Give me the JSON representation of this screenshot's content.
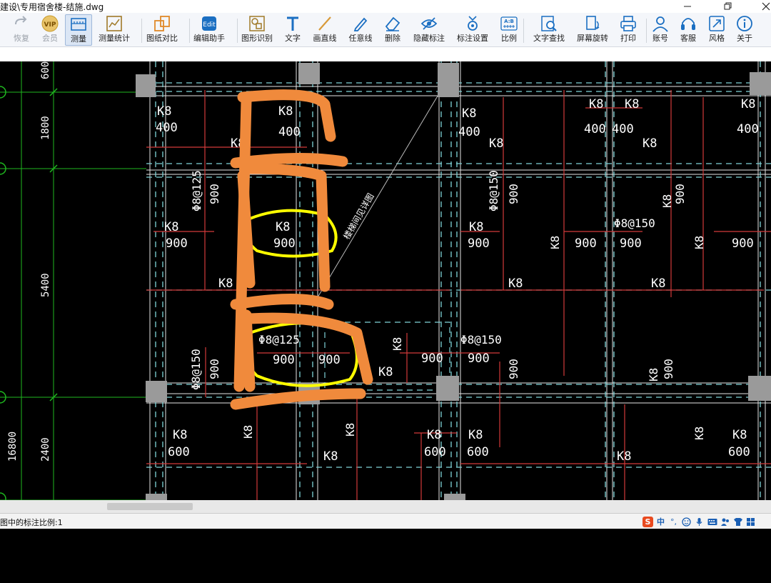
{
  "window": {
    "title": "建设\\专用宿舍楼-结施.dwg"
  },
  "toolbar": {
    "items": [
      {
        "label": "恢复",
        "icon": "redo-icon",
        "disabled": true
      },
      {
        "label": "会员",
        "icon": "vip-icon",
        "disabled": true
      },
      {
        "label": "测量",
        "icon": "measure-icon",
        "active": true
      },
      {
        "label": "测量统计",
        "icon": "measure-stats-icon"
      },
      {
        "label": "图纸对比",
        "icon": "compare-icon"
      },
      {
        "label": "编辑助手",
        "icon": "edit-assistant-icon"
      },
      {
        "label": "图形识别",
        "icon": "shape-recognition-icon"
      },
      {
        "label": "文字",
        "icon": "text-icon"
      },
      {
        "label": "画直线",
        "icon": "line-icon"
      },
      {
        "label": "任意线",
        "icon": "pen-icon"
      },
      {
        "label": "删除",
        "icon": "eraser-icon"
      },
      {
        "label": "隐藏标注",
        "icon": "hide-eye-icon"
      },
      {
        "label": "标注设置",
        "icon": "annotation-settings-icon"
      },
      {
        "label": "比例",
        "icon": "scale-icon"
      },
      {
        "label": "文字查找",
        "icon": "text-search-icon"
      },
      {
        "label": "屏幕旋转",
        "icon": "rotate-screen-icon"
      },
      {
        "label": "打印",
        "icon": "print-icon"
      },
      {
        "label": "账号",
        "icon": "user-icon"
      },
      {
        "label": "客服",
        "icon": "headset-icon"
      },
      {
        "label": "风格",
        "icon": "style-icon"
      },
      {
        "label": "关于",
        "icon": "info-icon"
      }
    ],
    "scale_icon_text": "A:B"
  },
  "drawing": {
    "dims_left": [
      "600",
      "1800",
      "5400",
      "2400"
    ],
    "dim_outer": "16800",
    "labels": {
      "k8": "K8",
      "n400": "400",
      "n600": "600",
      "n900": "900",
      "rebar125": "Φ8@125",
      "rebar150": "Φ8@150",
      "diag": "楼梯间见详图"
    },
    "colors": {
      "grid_green": "#1fb81f",
      "dashed_cyan": "#7fd3d8",
      "rebar_red": "#d23a3a",
      "text_white": "#ffffff",
      "column_gray": "#9a9a9a",
      "orange_markup": "#f08a3c",
      "yellow_markup": "#ffff00"
    }
  },
  "status": {
    "text": "图中的标注比例:1"
  },
  "ime": {
    "lang": "中",
    "punct": "°,"
  }
}
